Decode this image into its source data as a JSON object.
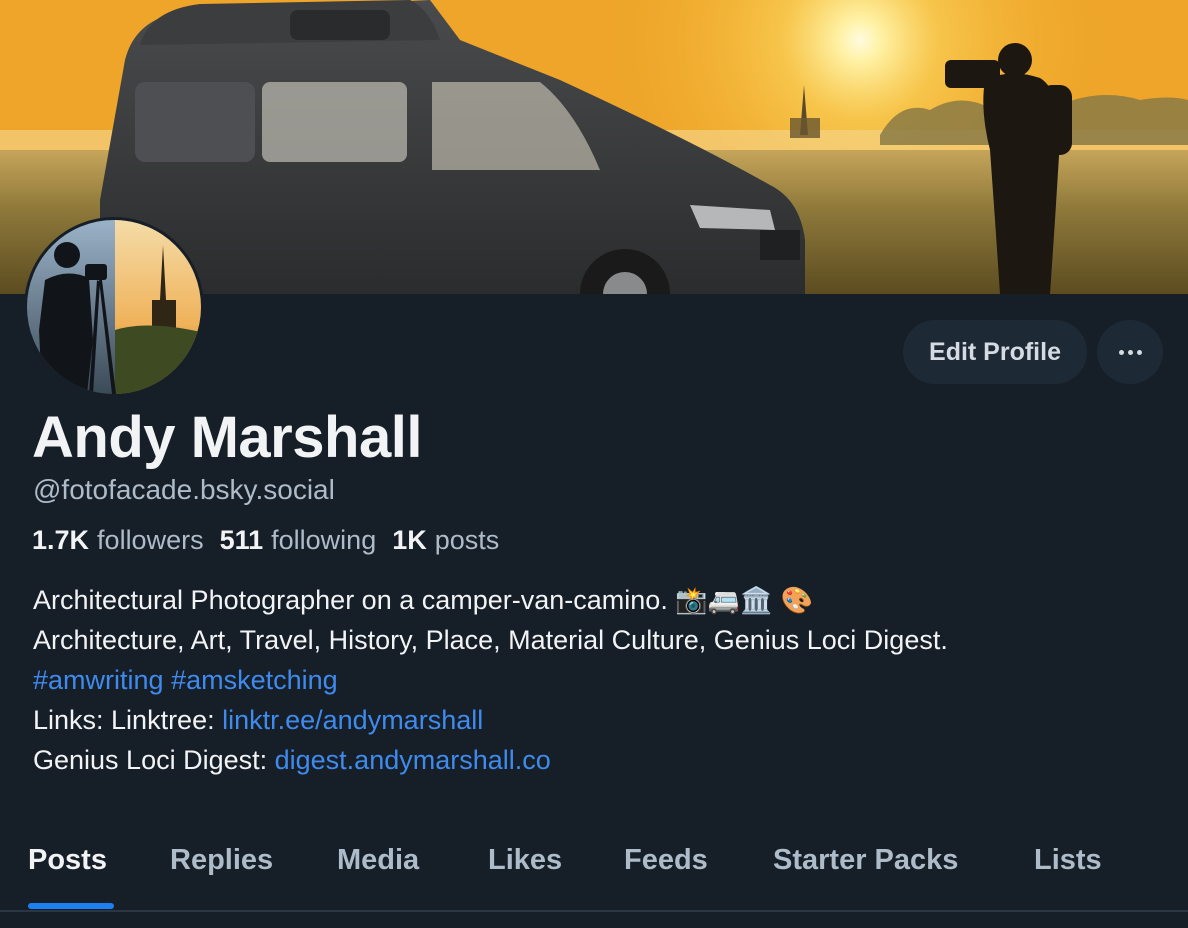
{
  "colors": {
    "background": "#161e27",
    "accent": "#1d7ff0",
    "link": "#3f8bed",
    "muted_text": "#aebbc9",
    "button_bg": "#1e2936"
  },
  "banner": {
    "icon": "cover-photo-campervan-sunrise"
  },
  "avatar": {
    "icon": "avatar-photographer-silhouette"
  },
  "actions": {
    "edit_profile_label": "Edit Profile",
    "more_icon": "ellipsis-icon"
  },
  "profile": {
    "display_name": "Andy Marshall",
    "handle": "@fotofacade.bsky.social"
  },
  "stats": {
    "followers_count": "1.7K",
    "followers_label": "followers",
    "following_count": "511",
    "following_label": "following",
    "posts_count": "1K",
    "posts_label": "posts"
  },
  "bio": {
    "line1_text": "Architectural Photographer on a camper-van-camino.",
    "line1_emojis": "📸🚐🏛️ 🎨",
    "line2": "Architecture, Art, Travel, History, Place, Material Culture, Genius Loci Digest.",
    "hashtag1": "#amwriting",
    "hashtag2": "#amsketching",
    "links_prefix": "Links: Linktree: ",
    "linktree_url": "linktr.ee/andymarshall",
    "digest_prefix": "Genius Loci Digest: ",
    "digest_url": "digest.andymarshall.co"
  },
  "tabs": [
    {
      "label": "Posts",
      "active": true
    },
    {
      "label": "Replies",
      "active": false
    },
    {
      "label": "Media",
      "active": false
    },
    {
      "label": "Likes",
      "active": false
    },
    {
      "label": "Feeds",
      "active": false
    },
    {
      "label": "Starter Packs",
      "active": false
    },
    {
      "label": "Lists",
      "active": false
    }
  ]
}
